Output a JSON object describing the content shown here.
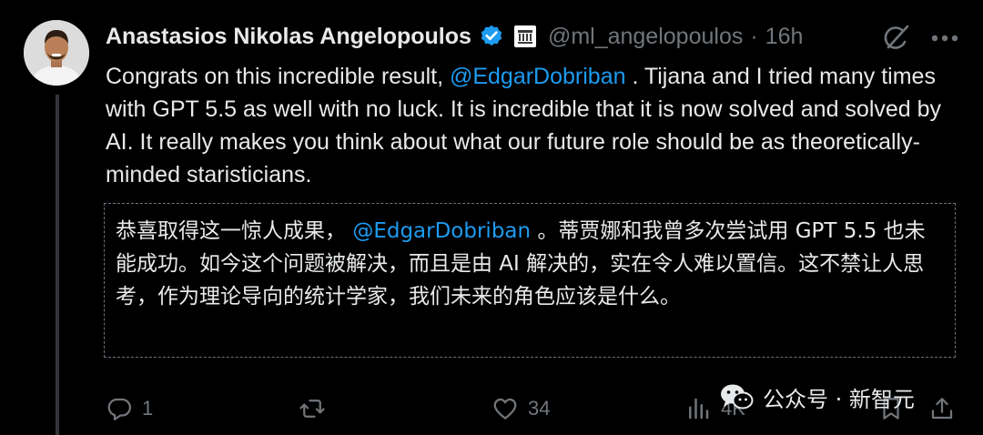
{
  "author": {
    "display_name": "Anastasios Nikolas Angelopoulos",
    "handle": "@ml_angelopoulos",
    "separator": "·",
    "time": "16h"
  },
  "tweet": {
    "text_before_mention": "Congrats on this incredible result, ",
    "mention": "@EdgarDobriban",
    "text_after_mention": " . Tijana and I tried many times with GPT 5.5 as well with no luck. It is incredible that it is now solved and solved by AI. It really makes you think about what our future role should be as theoretically-minded staristicians."
  },
  "translation": {
    "text_before_mention": "恭喜取得这一惊人成果， ",
    "mention": "@EdgarDobriban",
    "text_after_mention": " 。蒂贾娜和我曾多次尝试用 GPT 5.5 也未能成功。如今这个问题被解决，而且是由 AI 解决的，实在令人难以置信。这不禁让人思考，作为理论导向的统计学家，我们未来的角色应该是什么。"
  },
  "actions": {
    "reply_count": "1",
    "repost_count": "",
    "like_count": "34",
    "views_count": "4K"
  },
  "watermark": {
    "text": "公众号 · 新智元"
  },
  "colors": {
    "background": "#000000",
    "text_primary": "#e7e9ea",
    "text_secondary": "#71767b",
    "accent": "#1d9bf0"
  },
  "icons": {
    "verified": "verified-badge-icon",
    "affiliation": "affiliation-badge-icon",
    "grok": "grok-icon",
    "more": "more-icon",
    "reply": "reply-icon",
    "repost": "repost-icon",
    "like": "like-icon",
    "views": "views-icon",
    "bookmark": "bookmark-icon",
    "share": "share-icon"
  }
}
